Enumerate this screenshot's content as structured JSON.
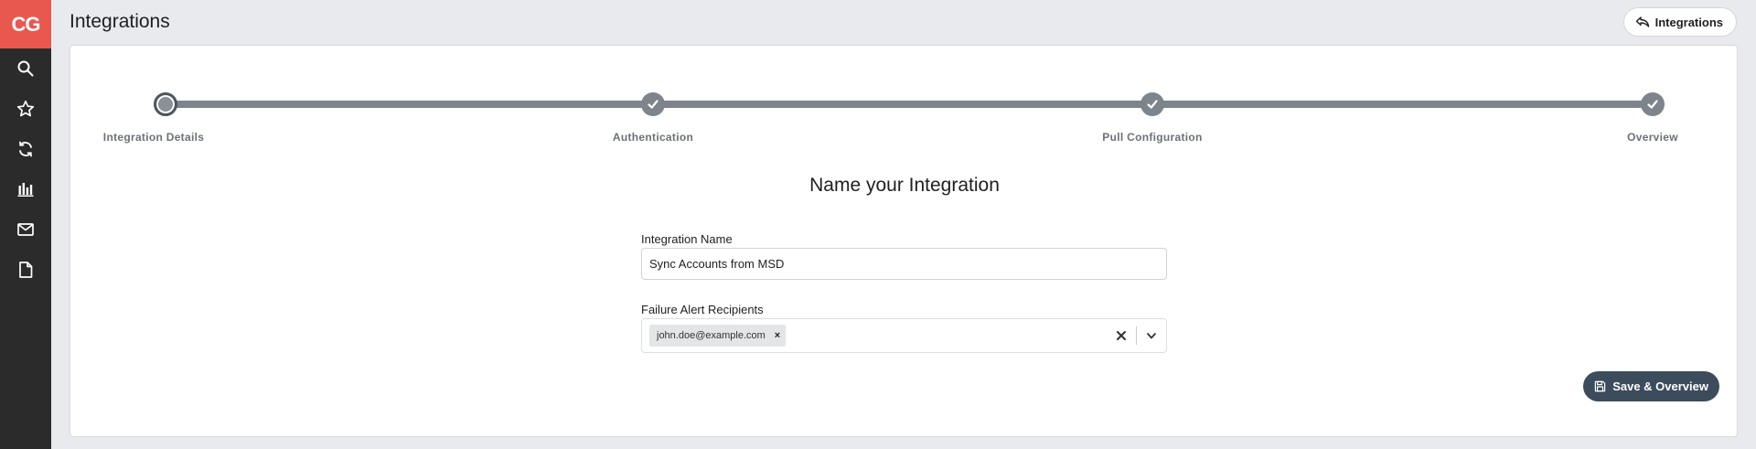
{
  "app": {
    "logo_text": "CG"
  },
  "sidebar": {
    "items": [
      {
        "icon": "search-icon"
      },
      {
        "icon": "star-icon"
      },
      {
        "icon": "sync-icon"
      },
      {
        "icon": "bar-chart-icon"
      },
      {
        "icon": "mail-icon"
      },
      {
        "icon": "document-icon"
      }
    ]
  },
  "header": {
    "title": "Integrations",
    "back_button_label": "Integrations"
  },
  "stepper": {
    "steps": [
      {
        "label": "Integration Details",
        "state": "current"
      },
      {
        "label": "Authentication",
        "state": "complete"
      },
      {
        "label": "Pull Configuration",
        "state": "complete"
      },
      {
        "label": "Overview",
        "state": "complete"
      }
    ]
  },
  "form": {
    "title": "Name your Integration",
    "integration_name_label": "Integration Name",
    "integration_name_value": "Sync Accounts from MSD",
    "recipients_label": "Failure Alert Recipients",
    "recipients": [
      "john.doe@example.com"
    ],
    "chip_remove_symbol": "×"
  },
  "footer": {
    "save_label": "Save & Overview"
  },
  "colors": {
    "brand": "#e8584f",
    "sidebar_bg": "#2b2b2b",
    "stepper": "#7d848c",
    "primary_button": "#3c4c5c"
  }
}
